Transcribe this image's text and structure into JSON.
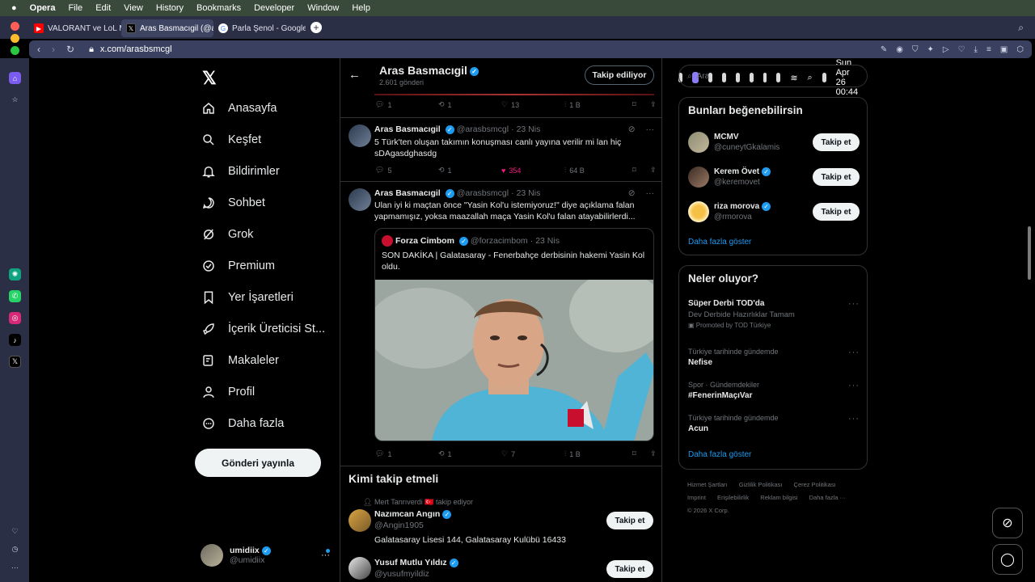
{
  "menubar": {
    "app": "Opera",
    "menus": [
      "File",
      "Edit",
      "View",
      "History",
      "Bookmarks",
      "Developer",
      "Window",
      "Help"
    ],
    "datetime": "Sun Apr 26  00:44"
  },
  "tabs": [
    {
      "label": "VALORANT ve LoL Milli T",
      "favicon": "youtube-icon",
      "color": "#ff0000"
    },
    {
      "label": "Aras Basmacıgil (@arasb",
      "favicon": "x-icon",
      "color": "#000000"
    },
    {
      "label": "Parla Şenol - Google'da",
      "favicon": "google-icon",
      "color": "#ffffff"
    }
  ],
  "address": {
    "url": "x.com/arasbsmcgl"
  },
  "nav": {
    "items": [
      {
        "label": "Anasayfa",
        "icon": "home-icon"
      },
      {
        "label": "Keşfet",
        "icon": "search-icon"
      },
      {
        "label": "Bildirimler",
        "icon": "bell-icon"
      },
      {
        "label": "Sohbet",
        "icon": "chat-icon"
      },
      {
        "label": "Grok",
        "icon": "grok-icon"
      },
      {
        "label": "Premium",
        "icon": "premium-icon"
      },
      {
        "label": "Yer İşaretleri",
        "icon": "bookmark-icon"
      },
      {
        "label": "İçerik Üreticisi St...",
        "icon": "rocket-icon"
      },
      {
        "label": "Makaleler",
        "icon": "article-icon"
      },
      {
        "label": "Profil",
        "icon": "person-icon"
      },
      {
        "label": "Daha fazla",
        "icon": "more-circle-icon"
      }
    ],
    "post_button": "Gönderi yayınla",
    "me": {
      "name": "umidiix",
      "handle": "@umidiix"
    }
  },
  "profile_header": {
    "name": "Aras Basmacıgil",
    "posts_count": "2.601 gönderi",
    "follow_state": "Takip ediliyor"
  },
  "tweets": [
    {
      "replies": "1",
      "retweets": "1",
      "likes": "13",
      "views": "1 B"
    },
    {
      "name": "Aras Basmacıgil",
      "handle": "@arasbsmcgl",
      "time": "23 Nis",
      "text": "5 Türk'ten oluşan takımın konuşması canlı yayına verilir mi lan hiç sDAgasdghasdg",
      "replies": "5",
      "retweets": "1",
      "likes": "354",
      "views": "64 B"
    },
    {
      "name": "Aras Basmacıgil",
      "handle": "@arasbsmcgl",
      "time": "23 Nis",
      "text": "Ulan iyi ki maçtan önce \"Yasin Kol'u istemiyoruz!\" diye açıklama falan yapmamışız, yoksa maazallah maça Yasin Kol'u falan atayabilirlerdi...",
      "quote": {
        "name": "Forza Cimbom",
        "handle": "@forzacimbom",
        "time": "23 Nis",
        "text": "SON DAKİKA | Galatasaray - Fenerbahçe derbisinin hakemi Yasin Kol oldu."
      },
      "replies": "1",
      "retweets": "1",
      "likes": "7",
      "views": "1 B"
    }
  ],
  "who_to_follow": {
    "title": "Kimi takip etmeli",
    "items": [
      {
        "context": "Mert Tanrıverdi 🇹🇷 takip ediyor",
        "name": "Nazımcan Angın",
        "handle": "@Angin1905",
        "bio": "Galatasaray Lisesi 144, Galatasaray Kulübü 16433",
        "button": "Takip et"
      },
      {
        "name": "Yusuf Mutlu Yıldız",
        "handle": "@yusufmyildiz",
        "button": "Takip et"
      }
    ]
  },
  "right": {
    "search_placeholder": "Ara",
    "suggestions": {
      "title": "Bunları beğenebilirsin",
      "items": [
        {
          "name": "MCMV",
          "handle": "@cuneytGkalamis",
          "button": "Takip et"
        },
        {
          "name": "Kerem Övet",
          "handle": "@keremovet",
          "button": "Takip et"
        },
        {
          "name": "riza morova",
          "handle": "@rmorova",
          "button": "Takip et"
        }
      ],
      "more": "Daha fazla göster"
    },
    "trends": {
      "title": "Neler oluyor?",
      "items": [
        {
          "meta": "",
          "title": "Süper Derbi TOD'da",
          "sub": "Dev Derbide Hazırlıklar Tamam",
          "promo": "Promoted by TOD Türkiye"
        },
        {
          "meta": "Türkiye tarihinde gündemde",
          "title": "Nefise"
        },
        {
          "meta": "Spor · Gündemdekiler",
          "title": "#FenerinMaçıVar"
        },
        {
          "meta": "Türkiye tarihinde gündemde",
          "title": "Acun"
        }
      ],
      "more": "Daha fazla göster"
    },
    "footer": [
      "Hizmet Şartları",
      "Gizlilik Politikası",
      "Çerez Politikası",
      "Imprint",
      "Erişilebilirlik",
      "Reklam bilgisi",
      "Daha fazla ···",
      "© 2026 X Corp."
    ]
  },
  "colors": {
    "accent": "#1d9bf0",
    "like": "#f91880",
    "bg": "#000000",
    "border": "#2f3336"
  }
}
